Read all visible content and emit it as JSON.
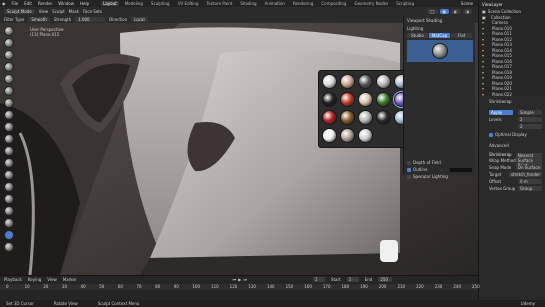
{
  "topbar": {
    "menus": [
      "File",
      "Edit",
      "Render",
      "Window",
      "Help"
    ],
    "workspaces": [
      "Layout",
      "Modeling",
      "Sculpting",
      "UV Editing",
      "Texture Paint",
      "Shading",
      "Animation",
      "Rendering",
      "Compositing",
      "Geometry Nodes",
      "Scripting"
    ],
    "active_workspace": "Layout",
    "scene": "Scene",
    "view_layer": "ViewLayer"
  },
  "header": {
    "mode": "Sculpt Mode",
    "menus": [
      "View",
      "Sculpt",
      "Mask",
      "Face Sets"
    ],
    "brush": "Smooth",
    "strength_label": "Strength",
    "strength_value": "1.000",
    "direction_label": "Direction",
    "falloff": "Local",
    "filter_type_label": "Filter Type"
  },
  "viewport_info": {
    "line1": "User Perspective",
    "line2": "(13) Plane.015"
  },
  "shading_popover": {
    "section": "Viewport Shading",
    "lighting_label": "Lighting",
    "lighting_modes": [
      "Studio",
      "MatCap",
      "Flat"
    ],
    "active_mode": "MatCap",
    "options": [
      {
        "label": "Depth of Field",
        "checked": false
      },
      {
        "label": "Outline",
        "checked": true
      },
      {
        "label": "Specular Lighting",
        "checked": false
      }
    ]
  },
  "matcaps": [
    "#d9d9d9",
    "#c9a48e",
    "#555555",
    "#b8b8b8",
    "#a7b7c8",
    "#a7a7a7",
    "#c061f0",
    "#e6e6e6",
    "#222222",
    "#c23a2a",
    "#d9c2a8",
    "#3c7a2e",
    "#7a5bbf",
    "#5e7b9a",
    "#8f8f8f",
    "#dcdcdc",
    "#b22222",
    "#8a5a2c",
    "#b5b5b5",
    "#2a2a2a",
    "#9fb7d1",
    "#e8e8e8",
    "#c9c9c9",
    "#9a9a9a",
    "#f0f0f0",
    "#b0a090",
    "#cfcfcf"
  ],
  "matcap_selected": 12,
  "outliner": {
    "items": [
      "Scene Collection",
      "Collection",
      "Camera",
      "Plane.010",
      "Plane.011",
      "Plane.012",
      "Plane.013",
      "Plane.014",
      "Plane.015",
      "Plane.016",
      "Plane.017",
      "Plane.018",
      "Plane.019",
      "Plane.020",
      "Plane.021",
      "Plane.022"
    ]
  },
  "properties": {
    "object": "Shrinkwrap",
    "modifier_name": "Shrinkwrap",
    "buttons": [
      "Apply",
      "Simple"
    ],
    "levels_label": "Levels",
    "optimal_display": "Optimal Display",
    "advanced_label": "Advanced",
    "wrap_method_label": "Wrap Method",
    "wrap_method": "Nearest Surface Point",
    "snap_mode_label": "Snap Mode",
    "snap_mode": "On Surface",
    "target_label": "Target",
    "target": "stretch_fender",
    "offset_label": "Offset",
    "offset": "0 m",
    "vertex_group_label": "Vertex Group",
    "vertex_group": "Group"
  },
  "timeline": {
    "menus": [
      "Playback",
      "Keying",
      "View",
      "Marker"
    ],
    "current_frame": "1",
    "start_label": "Start",
    "start": "1",
    "end_label": "End",
    "end": "250",
    "ticks": [
      "0",
      "10",
      "20",
      "30",
      "40",
      "50",
      "60",
      "70",
      "80",
      "90",
      "100",
      "110",
      "120",
      "130",
      "140",
      "150",
      "160",
      "170",
      "180",
      "190",
      "200",
      "210",
      "220",
      "230",
      "240",
      "250"
    ]
  },
  "status": {
    "left": "Set 3D Cursor",
    "middle": "Rotate View",
    "right": "Sculpt Context Menu",
    "brand": "Udemy"
  }
}
